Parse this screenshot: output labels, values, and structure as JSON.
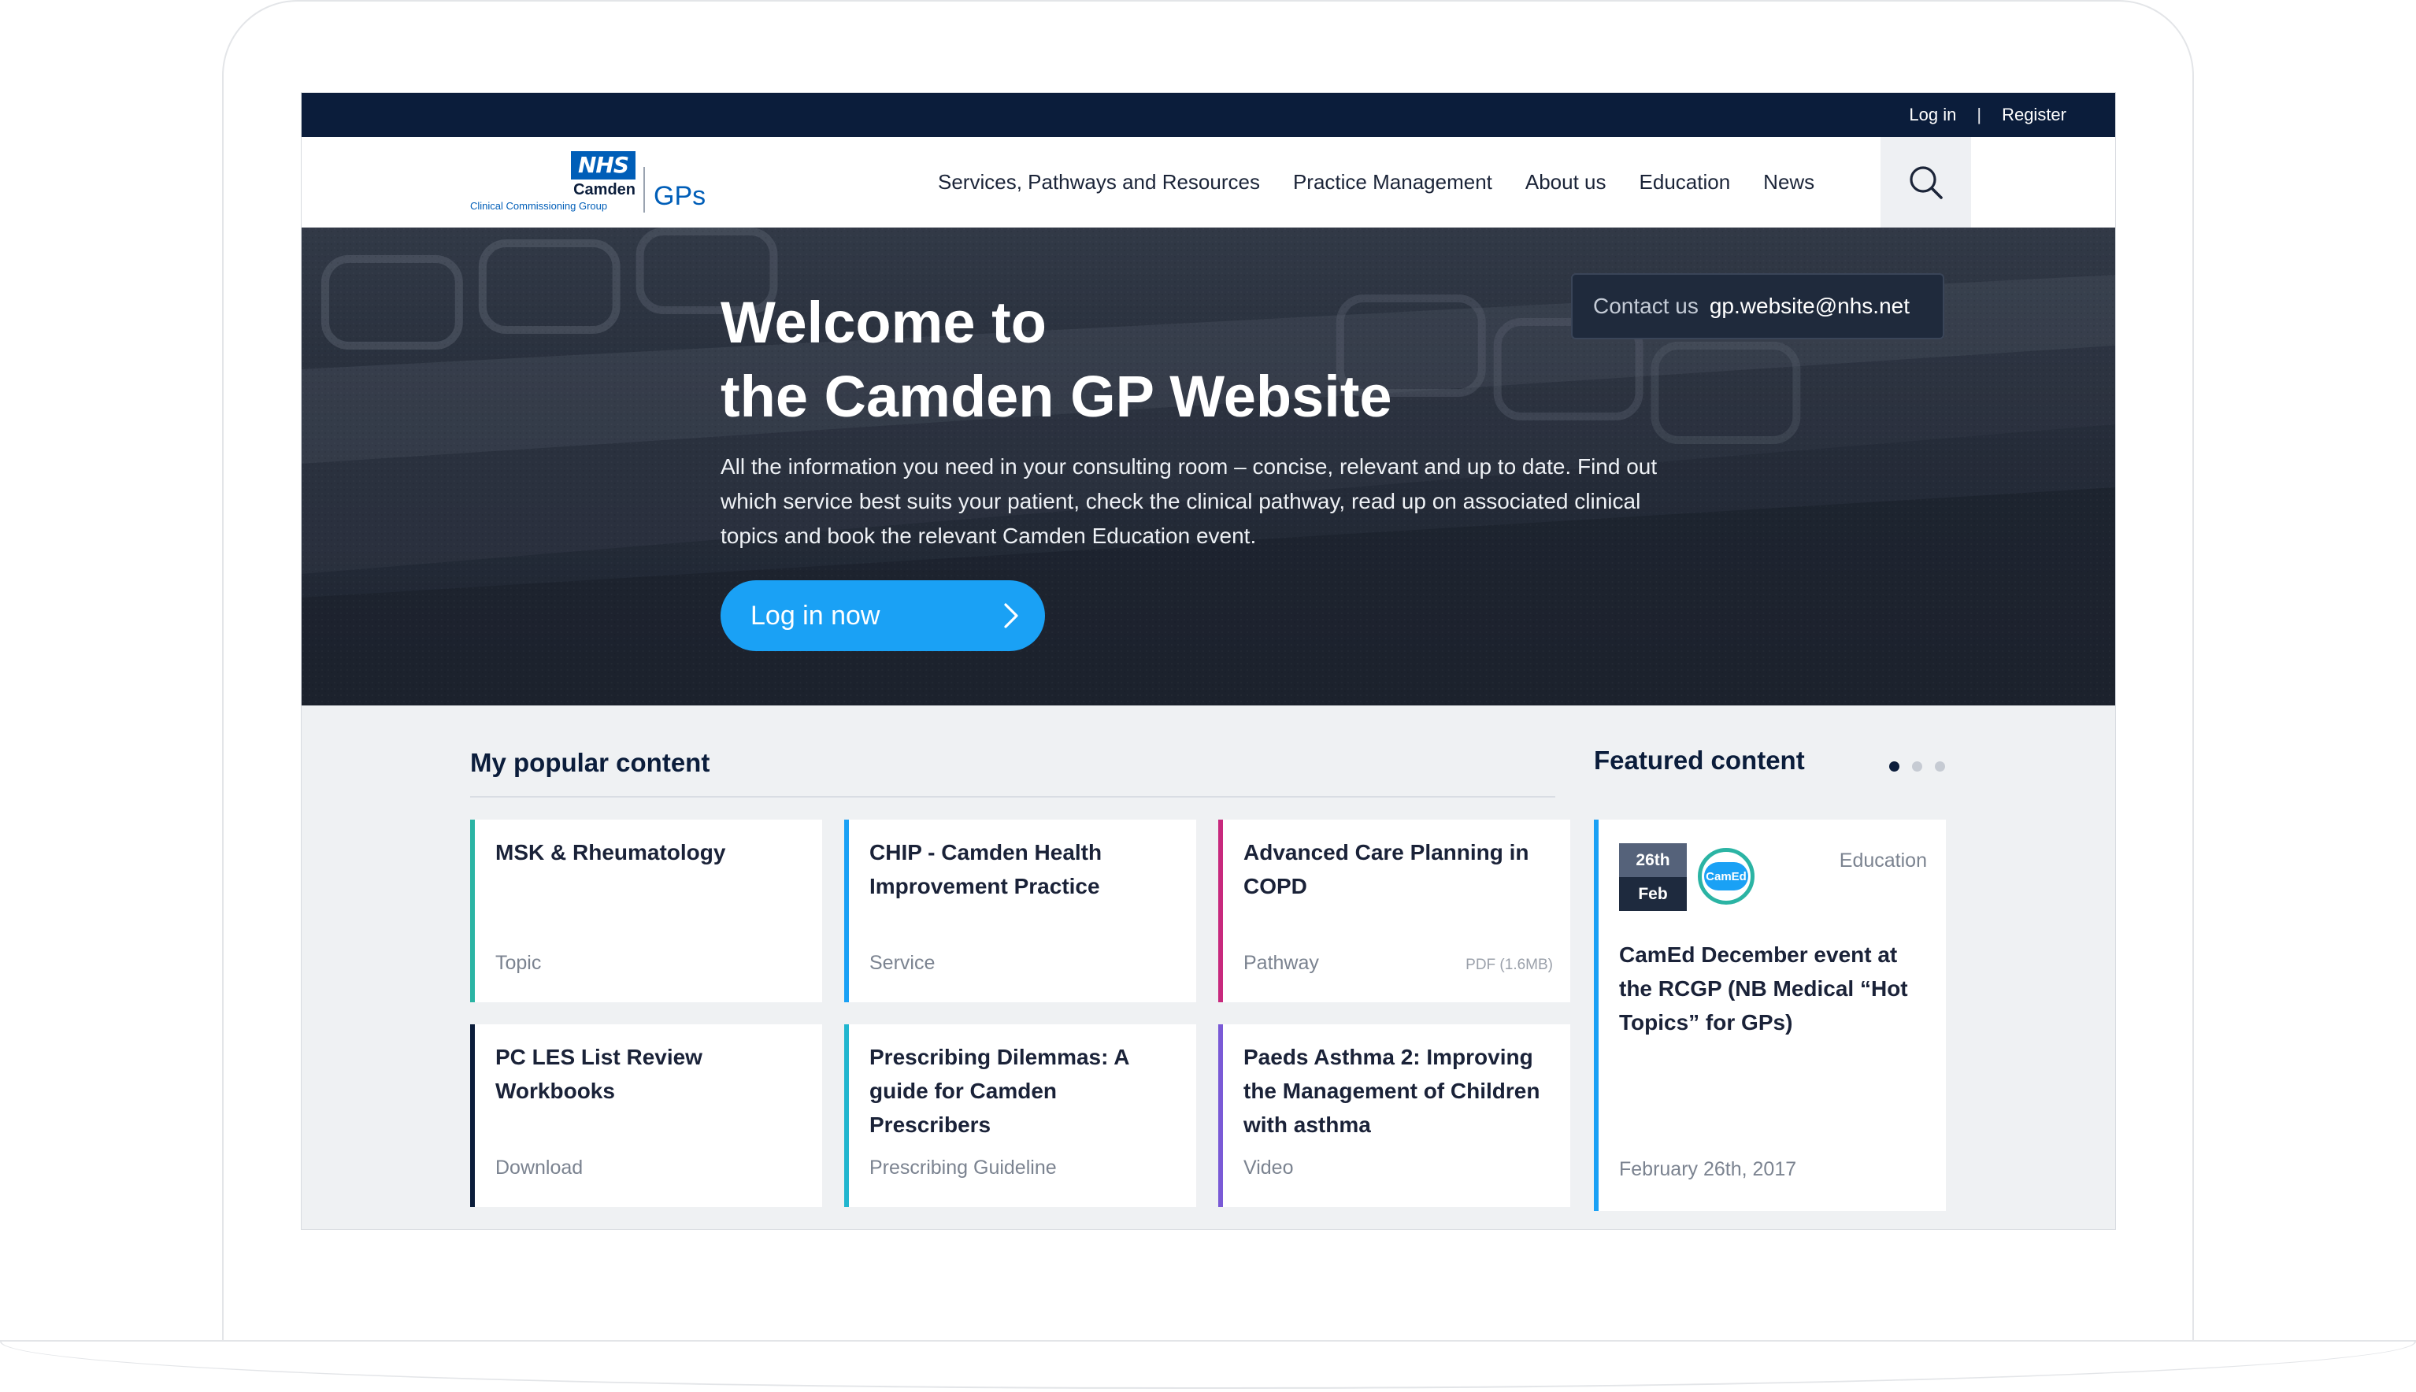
{
  "topbar": {
    "login": "Log in",
    "separator": "|",
    "register": "Register"
  },
  "logo": {
    "nhs": "NHS",
    "org": "Camden",
    "group": "Clinical Commissioning Group",
    "product": "GPs"
  },
  "nav": {
    "items": [
      "Services, Pathways and Resources",
      "Practice Management",
      "About us",
      "Education",
      "News"
    ]
  },
  "hero": {
    "title_line1": "Welcome to",
    "title_line2": "the Camden GP Website",
    "description": "All the information you need in your consulting room – concise, relevant and up to date. Find out which service best suits your patient, check the clinical pathway, read up on associated clinical topics and book the relevant Camden Education event.",
    "cta_label": "Log in now",
    "contact_label": "Contact us",
    "contact_email": "gp.website@nhs.net"
  },
  "popular": {
    "heading": "My popular content",
    "cards": [
      {
        "title": "MSK & Rheumatology",
        "type": "Topic",
        "meta": "",
        "accent": "#2bb4a4"
      },
      {
        "title": "CHIP - Camden Health Improvement Practice",
        "type": "Service",
        "meta": "",
        "accent": "#1aa1f5"
      },
      {
        "title": "Advanced Care Planning in COPD",
        "type": "Pathway",
        "meta": "PDF (1.6MB)",
        "accent": "#c8297d"
      },
      {
        "title": "PC LES List Review Workbooks",
        "type": "Download",
        "meta": "",
        "accent": "#0b1d3b"
      },
      {
        "title": "Prescribing Dilemmas: A guide for Camden Prescribers",
        "type": "Prescribing Guideline",
        "meta": "",
        "accent": "#21b6cf"
      },
      {
        "title": "Paeds Asthma 2: Improving the Management of Children with asthma",
        "type": "Video",
        "meta": "",
        "accent": "#7a5ad6"
      }
    ]
  },
  "featured": {
    "heading": "Featured content",
    "dots": 3,
    "active_dot": 1,
    "badge_day": "26th",
    "badge_month": "Feb",
    "brand": "CamEd",
    "category": "Education",
    "title": "CamEd December event at the RCGP (NB Medical “Hot Topics” for GPs)",
    "date": "February 26th, 2017"
  },
  "icons": {
    "search": "search-icon",
    "chevron": "chevron-right-icon"
  }
}
